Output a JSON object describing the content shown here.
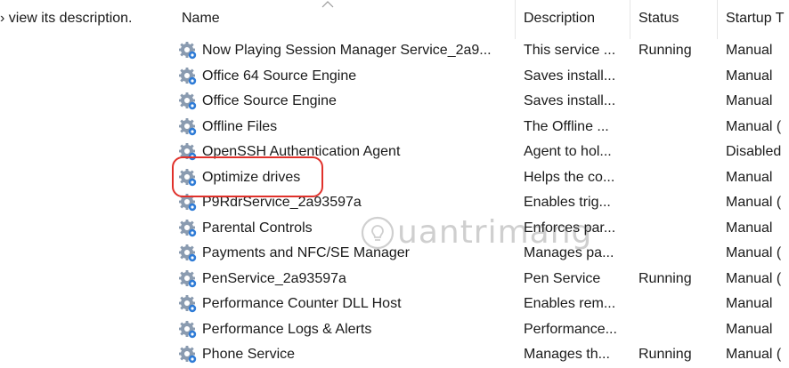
{
  "left_panel": {
    "description_hint": "› view its description."
  },
  "columns": {
    "name": "Name",
    "description": "Description",
    "status": "Status",
    "startup_type": "Startup T"
  },
  "services": [
    {
      "name": "Now Playing Session Manager Service_2a9...",
      "description": "This service ...",
      "status": "Running",
      "startup_type": "Manual"
    },
    {
      "name": "Office 64 Source Engine",
      "description": "Saves install...",
      "status": "",
      "startup_type": "Manual"
    },
    {
      "name": "Office Source Engine",
      "description": "Saves install...",
      "status": "",
      "startup_type": "Manual"
    },
    {
      "name": "Offline Files",
      "description": "The Offline ...",
      "status": "",
      "startup_type": "Manual ("
    },
    {
      "name": "OpenSSH Authentication Agent",
      "description": "Agent to hol...",
      "status": "",
      "startup_type": "Disabled"
    },
    {
      "name": "Optimize drives",
      "description": "Helps the co...",
      "status": "",
      "startup_type": "Manual"
    },
    {
      "name": "P9RdrService_2a93597a",
      "description": "Enables trig...",
      "status": "",
      "startup_type": "Manual ("
    },
    {
      "name": "Parental Controls",
      "description": "Enforces par...",
      "status": "",
      "startup_type": "Manual"
    },
    {
      "name": "Payments and NFC/SE Manager",
      "description": "Manages pa...",
      "status": "",
      "startup_type": "Manual ("
    },
    {
      "name": "PenService_2a93597a",
      "description": "Pen Service",
      "status": "Running",
      "startup_type": "Manual ("
    },
    {
      "name": "Performance Counter DLL Host",
      "description": "Enables rem...",
      "status": "",
      "startup_type": "Manual"
    },
    {
      "name": "Performance Logs & Alerts",
      "description": "Performance...",
      "status": "",
      "startup_type": "Manual"
    },
    {
      "name": "Phone Service",
      "description": "Manages th...",
      "status": "Running",
      "startup_type": "Manual ("
    }
  ],
  "highlighted_service": "Optimize drives",
  "watermark": {
    "text": "uantrimang"
  },
  "colors": {
    "highlight_border": "#e0312b",
    "gear_primary": "#8a9bb0",
    "gear_accent": "#2e7bd6"
  },
  "icons": {
    "service": "gear-icon",
    "sort": "chevron-up-icon"
  }
}
